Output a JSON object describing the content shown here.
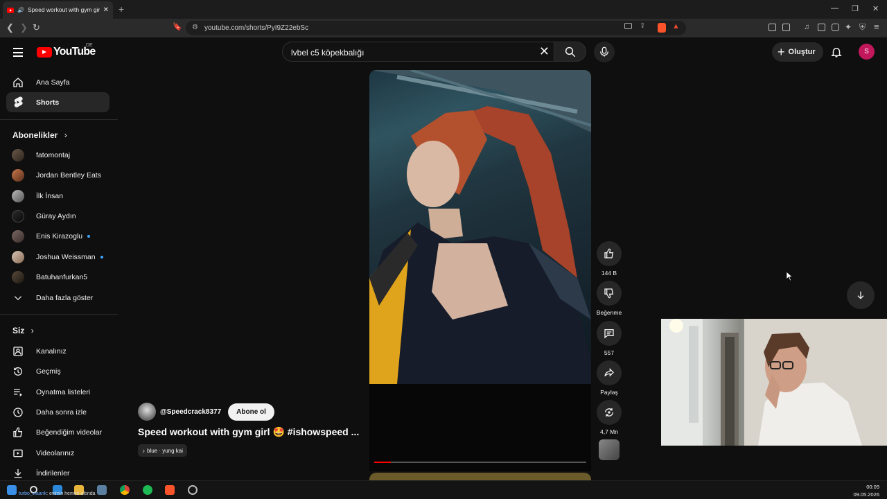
{
  "browser": {
    "tab_title": "Speed workout with gym girl 🤩 #ishowspeed",
    "url": "youtube.com/shorts/PyI9Z22ebSc"
  },
  "header": {
    "logo_text": "YouTube",
    "country_code": "DE",
    "search_query": "lvbel c5 köpekbalığı",
    "create_label": "Oluştur",
    "avatar_letter": "S"
  },
  "sidebar": {
    "main_items": [
      {
        "label": "Ana Sayfa",
        "icon": "home-icon"
      },
      {
        "label": "Shorts",
        "icon": "shorts-icon",
        "active": true
      }
    ],
    "subscriptions_heading": "Abonelikler",
    "subscriptions": [
      {
        "label": "fatomontaj",
        "live": false
      },
      {
        "label": "Jordan Bentley Eats",
        "live": false
      },
      {
        "label": "İlk İnsan",
        "live": false
      },
      {
        "label": "Güray Aydın",
        "live": false
      },
      {
        "label": "Enis Kirazoglu",
        "live": true
      },
      {
        "label": "Joshua Weissman",
        "live": true
      },
      {
        "label": "Batuhanfurkan5",
        "live": false
      }
    ],
    "show_more": "Daha fazla göster",
    "you_heading": "Siz",
    "you_items": [
      {
        "label": "Kanalınız",
        "icon": "channel-icon"
      },
      {
        "label": "Geçmiş",
        "icon": "history-icon"
      },
      {
        "label": "Oynatma listeleri",
        "icon": "playlist-icon"
      },
      {
        "label": "Daha sonra izle",
        "icon": "watch-later-icon"
      },
      {
        "label": "Beğendiğim videolar",
        "icon": "like-icon"
      },
      {
        "label": "Videolarınız",
        "icon": "your-videos-icon"
      },
      {
        "label": "İndirilenler",
        "icon": "download-icon"
      }
    ]
  },
  "short": {
    "channel": "@Speedcrack8377",
    "subscribe_label": "Abone ol",
    "title": "Speed workout with gym girl 🤩 #ishowspeed ...",
    "music": "blue · yung kai",
    "progress_fraction": 0.08,
    "actions": {
      "like_count": "144 B",
      "dislike_label": "Beğenme",
      "comment_count": "557",
      "share_label": "Paylaş",
      "remix_count": "4,7 Mn"
    }
  },
  "taskbar": {
    "ticker_user": "turbo_waank",
    "ticker_text": ": evimin hemen altında",
    "time": "00:09",
    "date": "09.05.2026"
  },
  "colors": {
    "accent_red": "#ff0000",
    "background": "#0f0f0f",
    "chip": "#272727"
  }
}
